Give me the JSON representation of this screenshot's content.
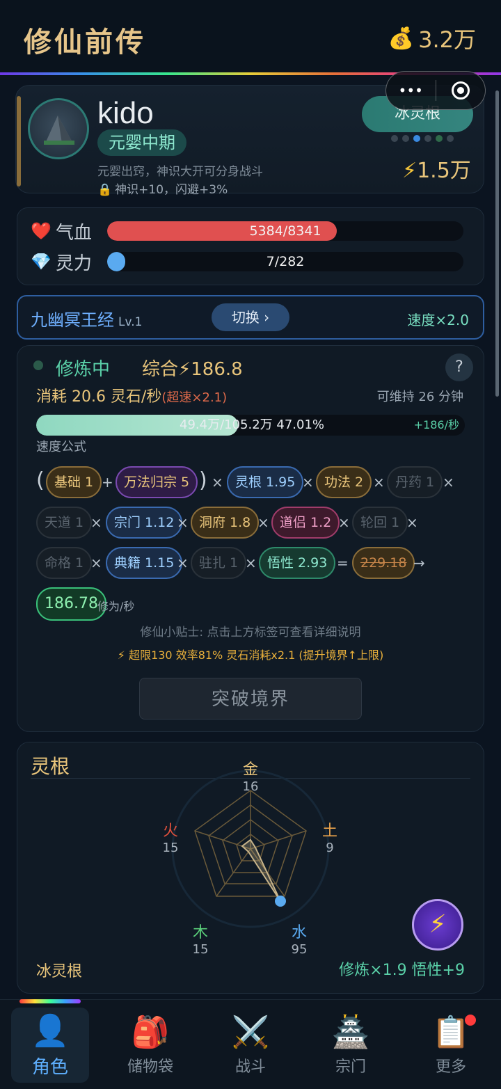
{
  "header": {
    "title": "修仙前传",
    "money": "3.2万"
  },
  "profile": {
    "name": "kido",
    "realm": "元婴中期",
    "desc": "元婴出窍，神识大开可分身战斗",
    "perk": "神识+10，闪避+3%",
    "root_badge": "冰灵根",
    "power": "1.5万",
    "dot_colors": [
      "#3a4652",
      "#3a4652",
      "#3a8ae0",
      "#3a4652",
      "#2f6a4a",
      "#3a4652"
    ]
  },
  "stats": {
    "hp": {
      "label": "气血",
      "text": "5384/8341",
      "value": 5384,
      "max": 8341,
      "color": "#e05050"
    },
    "mp": {
      "label": "灵力",
      "text": "7/282",
      "value": 7,
      "max": 282,
      "color": "#5aaaf0"
    }
  },
  "technique": {
    "name": "九幽冥王经",
    "level": "Lv.1",
    "switch": "切换 ›",
    "speed": "速度×2.0"
  },
  "cultivation": {
    "status": "修炼中",
    "composite": "综合⚡186.8",
    "help": "?",
    "consume": "消耗 20.6 灵石/秒",
    "overspeed": "(超速×2.1)",
    "sustain": "可维持 26 分钟",
    "exp_text": "49.4万/105.2万  47.01%",
    "exp_fraction": 0.4701,
    "exp_rate": "+186/秒",
    "formula_label": "速度公式",
    "pills": {
      "base": "基础 1",
      "wanfa": "万法归宗 5",
      "root": "灵根 1.95",
      "gongfa": "功法 2",
      "danyao": "丹药 1",
      "tiandao": "天道 1",
      "zongmen": "宗门 1.12",
      "dongfu": "洞府 1.8",
      "daolv": "道侣 1.2",
      "lunhui": "轮回 1",
      "mingge": "命格 1",
      "dianji": "典籍 1.15",
      "zhuzha": "驻扎 1",
      "wuxing": "悟性 2.93",
      "raw": "229.18",
      "result": "186.78"
    },
    "result_unit": "修为/秒",
    "tip": "修仙小贴士: 点击上方标签可查看详细说明",
    "limit": "⚡ 超限130 效率81% 灵石消耗x2.1 (提升境界↑上限)",
    "breakthrough": "突破境界"
  },
  "spirit_root": {
    "title": "灵根",
    "elements": [
      {
        "name": "金",
        "value": "16",
        "color": "#e9c57b"
      },
      {
        "name": "土",
        "value": "9",
        "color": "#e9a24b"
      },
      {
        "name": "水",
        "value": "95",
        "color": "#5aaaf0"
      },
      {
        "name": "木",
        "value": "15",
        "color": "#5ad07a"
      },
      {
        "name": "火",
        "value": "15",
        "color": "#e0503c"
      }
    ],
    "type": "冰灵根",
    "bonus": "修炼×1.9  悟性+9"
  },
  "nav": {
    "items": [
      {
        "label": "角色",
        "icon": "👤"
      },
      {
        "label": "储物袋",
        "icon": "🎒"
      },
      {
        "label": "战斗",
        "icon": "⚔️"
      },
      {
        "label": "宗门",
        "icon": "🏯"
      },
      {
        "label": "更多",
        "icon": "📋"
      }
    ]
  }
}
